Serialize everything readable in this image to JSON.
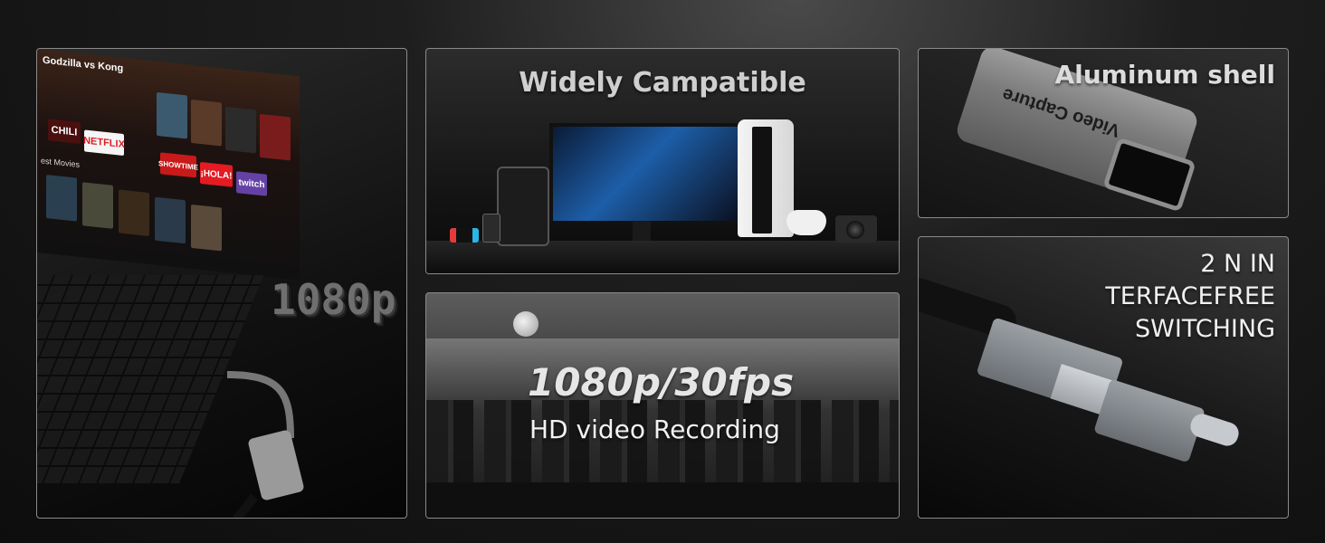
{
  "panels": {
    "compatible": {
      "title": "Widely Campatible"
    },
    "recording": {
      "title": "1080p/30fps",
      "subtitle": "HD video Recording"
    },
    "shell": {
      "title": "Aluminum shell",
      "device_label": "Video Capture"
    },
    "switching": {
      "title_lines": [
        "2 N IN",
        "TERFACEFREE",
        "SWITCHING"
      ]
    },
    "laptop": {
      "resolution_badge": "1080p",
      "screen": {
        "movie_title": "Godzilla vs Kong",
        "row_label": "est Movies",
        "tiles": {
          "netflix": "NETFLIX",
          "chili": "CHILI",
          "showtime": "SHOWTIME",
          "hola": "¡HOLA!",
          "twitch": "twitch"
        }
      }
    }
  },
  "icons": {
    "laptop": "laptop-icon",
    "monitor": "monitor-icon",
    "game-console": "game-console-icon",
    "gamepad": "gamepad-icon",
    "camera": "camera-icon",
    "capture-adapter": "hdmi-adapter-icon",
    "usb-connector": "usb-connector-icon"
  },
  "colors": {
    "background": "#0d0d0d",
    "panel_border": "#8a8a8a",
    "heading": "#d9d9d9"
  }
}
